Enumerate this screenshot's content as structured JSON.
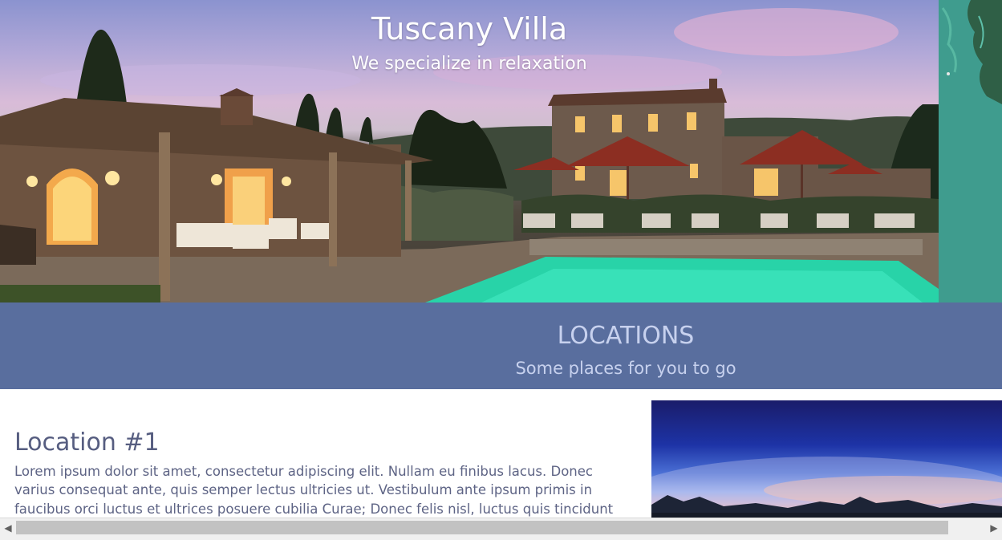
{
  "hero": {
    "title": "Tuscany Villa",
    "subtitle": "We specialize in relaxation"
  },
  "locations_band": {
    "title": "LOCATIONS",
    "subtitle": "Some places for you to go"
  },
  "location_1": {
    "title": "Location #1",
    "text": "Lorem ipsum dolor sit amet, consectetur adipiscing elit. Nullam eu finibus lacus. Donec varius consequat ante, quis semper lectus ultricies ut. Vestibulum ante ipsum primis in faucibus orci luctus et ultrices posuere cubilia Curae; Donec felis nisl, luctus quis tincidunt nec, blandit ut nibh. Nulla aliquet malesuada felis semper"
  },
  "scrollbar": {
    "left_arrow": "◀",
    "right_arrow": "▶"
  },
  "colors": {
    "band": "#596e9e",
    "band_text": "#c7d1ee",
    "heading": "#565d80",
    "body_text": "#5e6485",
    "map": "#3f9c8e"
  },
  "icons": {
    "scroll_left": "triangle-left-icon",
    "scroll_right": "triangle-right-icon"
  }
}
